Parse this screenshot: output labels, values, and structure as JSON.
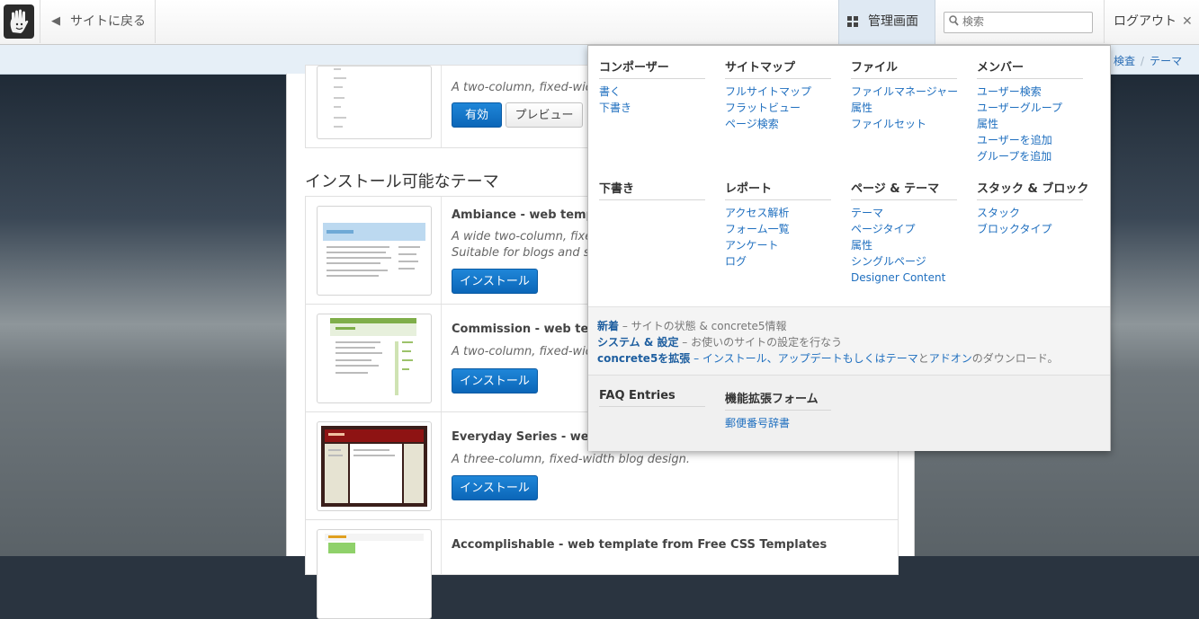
{
  "toolbar": {
    "back_label": "サイトに戻る",
    "dashboard_label": "管理画面",
    "search_placeholder": "検索",
    "logout_label": "ログアウト",
    "logout_icon": "✕"
  },
  "breadcrumb": [
    "検査",
    "テーマ"
  ],
  "themes": {
    "current": {
      "desc": "A two-column, fixed-width d",
      "activate_label": "有効",
      "preview_label": "プレビュー"
    },
    "installable_title": "インストール可能なテーマ",
    "install_label": "インストール",
    "items": [
      {
        "name": "Ambiance - web templat",
        "desc": [
          "A wide two-column, fixed w",
          "Suitable for blogs and sma"
        ]
      },
      {
        "name": "Commission - web temp",
        "desc": [
          "A two-column, fixed-width d"
        ]
      },
      {
        "name": "Everyday Series - web te",
        "desc": [
          "A three-column, fixed-width blog design."
        ]
      },
      {
        "name": "Accomplishable - web template from Free CSS Templates",
        "desc": []
      }
    ]
  },
  "menu": {
    "columns": [
      {
        "title": "コンポーザー",
        "items": [
          "書く",
          "下書き"
        ]
      },
      {
        "title": "サイトマップ",
        "items": [
          "フルサイトマップ",
          "フラットビュー",
          "ページ検索"
        ]
      },
      {
        "title": "ファイル",
        "items": [
          "ファイルマネージャー",
          "属性",
          "ファイルセット"
        ]
      },
      {
        "title": "メンバー",
        "items": [
          "ユーザー検索",
          "ユーザーグループ",
          "属性",
          "ユーザーを追加",
          "グループを追加"
        ]
      },
      {
        "title": "下書き",
        "items": []
      },
      {
        "title": "レポート",
        "items": [
          "アクセス解析",
          "フォーム一覧",
          "アンケート",
          "ログ"
        ]
      },
      {
        "title": "ページ & テーマ",
        "items": [
          "テーマ",
          "ページタイプ",
          "属性",
          "シングルページ",
          "Designer Content"
        ]
      },
      {
        "title": "スタック & ブロック",
        "items": [
          "スタック",
          "ブロックタイプ"
        ]
      }
    ],
    "footer": {
      "news_label": "新着",
      "news_text": " – サイトの状態 & concrete5情報",
      "system_label": "システム & 設定",
      "system_text": " – お使いのサイトの設定を行なう",
      "extend_label": "concrete5を拡張",
      "extend_text_1": " – インストール、アップデートもしくは",
      "extend_link_themes": "テーマ",
      "extend_text_2": "と",
      "extend_link_addons": "アドオン",
      "extend_text_3": "のダウンロード。"
    },
    "extensions": [
      {
        "title": "FAQ Entries",
        "items": []
      },
      {
        "title": "機能拡張フォーム",
        "items": [
          "郵便番号辞書"
        ]
      }
    ]
  },
  "colors": {
    "accent": "#0b66b8",
    "link": "#1f6fbf"
  },
  "icons": [
    "concrete5-logo-icon",
    "back-arrow-icon",
    "dashboard-grid-icon",
    "search-icon",
    "close-icon"
  ]
}
